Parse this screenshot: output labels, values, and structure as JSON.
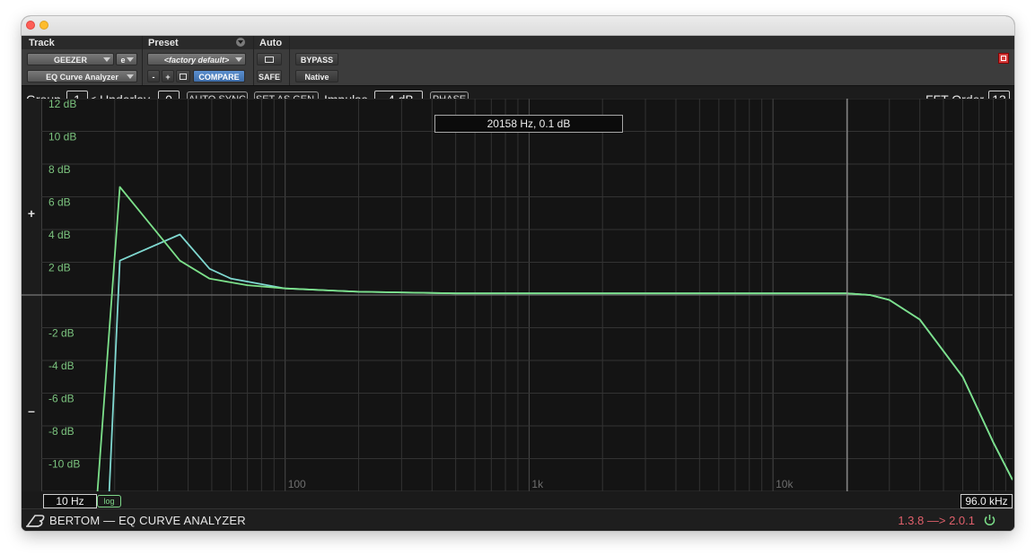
{
  "header": {
    "track_label": "Track",
    "preset_label": "Preset",
    "auto_label": "Auto",
    "track_name": "GEEZER",
    "track_channel": "e",
    "plugin_name": "EQ Curve Analyzer",
    "preset_name": "<factory default>",
    "minus_label": "-",
    "plus_label": "+",
    "compare_label": "COMPARE",
    "bypass_label": "BYPASS",
    "safe_label": "SAFE",
    "native_label": "Native"
  },
  "toolbar": {
    "group_label": "Group",
    "group_value": "1",
    "underlay_label": "< Underlay",
    "underlay_value": "0",
    "auto_sync_label": "AUTO SYNC",
    "set_as_gen_label": "SET AS GEN.",
    "impulse_label": "Impulse",
    "impulse_value": "-4 dB",
    "phase_label": "PHASE",
    "fft_order_label": "FFT Order",
    "fft_order_value": "13"
  },
  "plot": {
    "readout": "20158 Hz, 0.1 dB",
    "min_freq": "10 Hz",
    "max_freq": "96.0 kHz",
    "log_label": "log",
    "plus_sign": "+",
    "minus_sign": "–",
    "db_labels": [
      "12 dB",
      "10 dB",
      "8 dB",
      "6 dB",
      "4 dB",
      "2 dB",
      "-2 dB",
      "-4 dB",
      "-6 dB",
      "-8 dB",
      "-10 dB"
    ],
    "freq_labels": [
      "100",
      "1k",
      "10k"
    ]
  },
  "footer": {
    "brand": "BERTOM — EQ CURVE ANALYZER",
    "version": "1.3.8 —> 2.0.1"
  },
  "colors": {
    "curve_green": "#7ce08a",
    "curve_cyan": "#7fd8d0",
    "db_label": "#7cc47f",
    "version": "#e0606b",
    "compare_blue": "#4a7cbd"
  },
  "chart_data": {
    "type": "line",
    "title": "",
    "xlabel": "",
    "ylabel": "",
    "x_scale": "log",
    "xlim": [
      10,
      96000
    ],
    "ylim": [
      -12,
      12
    ],
    "grid": true,
    "series": [
      {
        "x": [
          17,
          21,
          37,
          49,
          70,
          100,
          200,
          500,
          1000,
          5000,
          10000,
          15000,
          20000,
          25000,
          30000,
          40000,
          60000,
          80000,
          96000
        ],
        "y": [
          -12,
          6.6,
          2.1,
          1.0,
          0.6,
          0.4,
          0.2,
          0.1,
          0.1,
          0.1,
          0.1,
          0.1,
          0.1,
          0,
          -0.3,
          -1.5,
          -5,
          -9,
          -11.3
        ]
      },
      {
        "x": [
          19,
          21,
          37,
          49,
          60,
          100,
          200,
          500,
          1000,
          5000,
          10000,
          15000,
          20000,
          25000,
          30000,
          40000,
          60000,
          80000,
          96000
        ],
        "y": [
          -12,
          2.1,
          3.7,
          1.6,
          1.0,
          0.4,
          0.2,
          0.1,
          0.1,
          0.1,
          0.1,
          0.1,
          0.1,
          0,
          -0.3,
          -1.5,
          -5,
          -9,
          -11.3
        ]
      }
    ]
  }
}
